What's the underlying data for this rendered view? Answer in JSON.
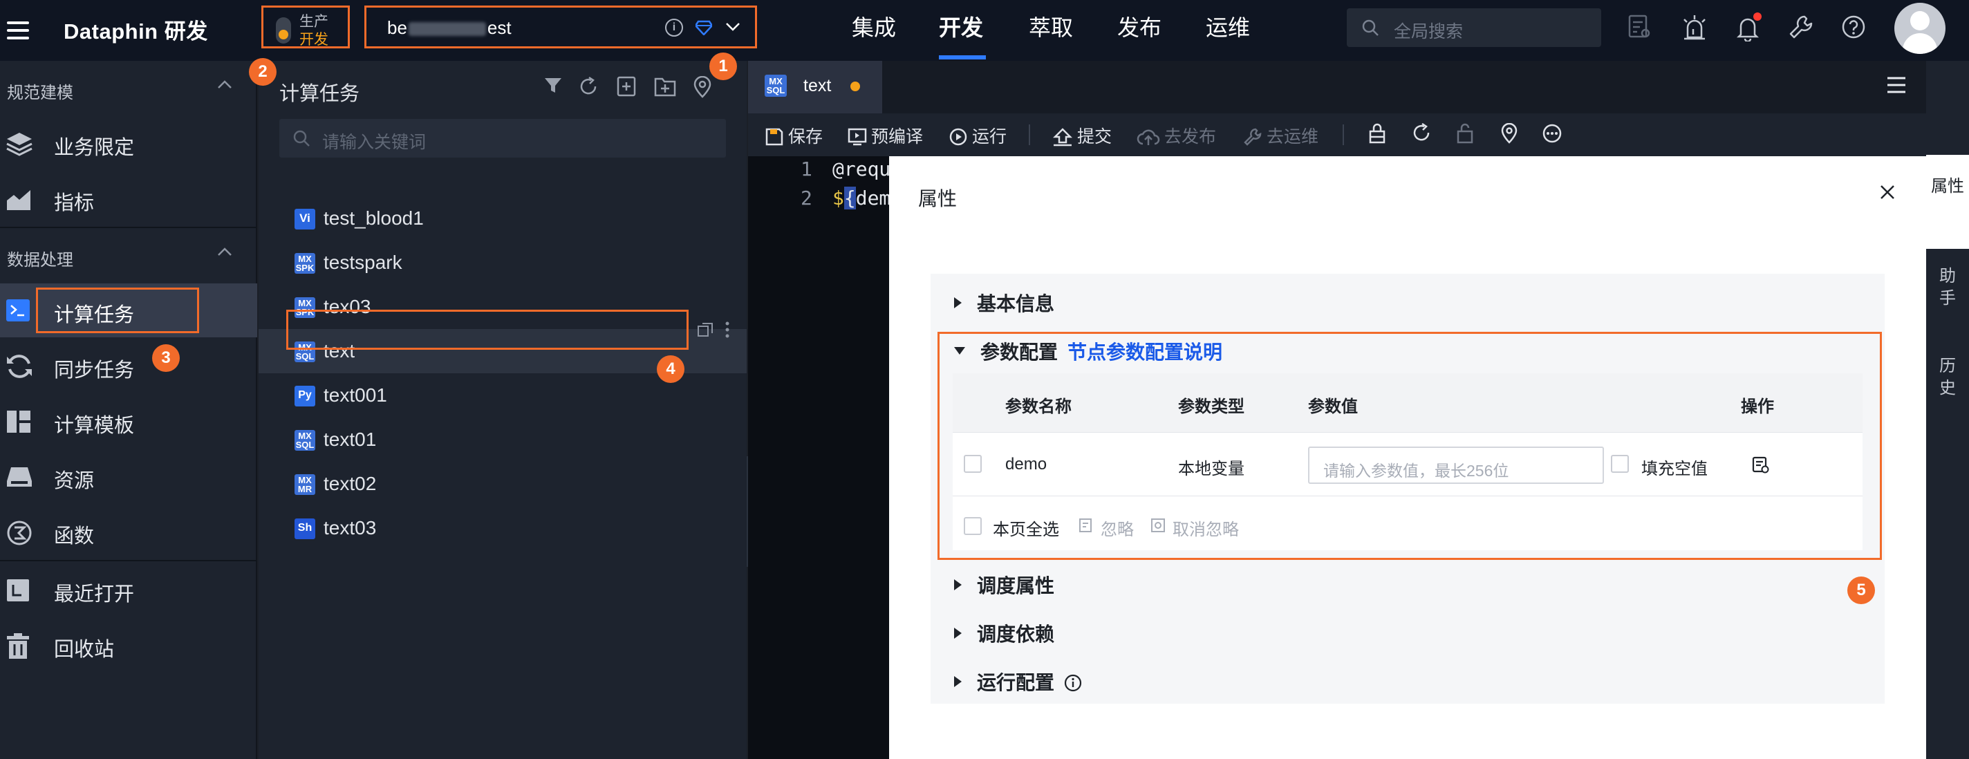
{
  "topbar": {
    "brand": "Dataphin 研发",
    "env": {
      "prod": "生产",
      "dev": "开发"
    },
    "project": {
      "name_start": "be",
      "name_end": "est"
    },
    "nav": [
      "集成",
      "开发",
      "萃取",
      "发布",
      "运维"
    ],
    "active_nav": "开发",
    "search_placeholder": "全局搜索"
  },
  "leftnav": {
    "groups": [
      {
        "label": "规范建模",
        "items": [
          "业务限定",
          "指标"
        ]
      },
      {
        "label": "数据处理",
        "items": [
          "计算任务",
          "同步任务",
          "计算模板",
          "资源",
          "函数"
        ]
      }
    ],
    "bottom_items": [
      "最近打开",
      "回收站"
    ],
    "active": "计算任务"
  },
  "taskpanel": {
    "title": "计算任务",
    "search_placeholder": "请输入关键词",
    "files": [
      {
        "name": "test_blood1",
        "type": "Vi"
      },
      {
        "name": "testspark",
        "type": "SPK"
      },
      {
        "name": "tex03",
        "type": "SPK"
      },
      {
        "name": "text",
        "type": "SQL"
      },
      {
        "name": "text001",
        "type": "Py"
      },
      {
        "name": "text01",
        "type": "SQL"
      },
      {
        "name": "text02",
        "type": "MR"
      },
      {
        "name": "text03",
        "type": "Sh"
      }
    ],
    "selected": "text"
  },
  "editor": {
    "tab": {
      "name": "text",
      "badge": "MX SQL"
    },
    "toolbar": [
      "保存",
      "预编译",
      "运行",
      "提交",
      "去发布",
      "去运维"
    ],
    "lines": [
      {
        "num": "1",
        "text": "@requ"
      },
      {
        "num": "2",
        "prefix": "$",
        "brace": "{",
        "text": "dem"
      }
    ]
  },
  "drawer": {
    "title": "属性",
    "sections": [
      "基本信息",
      "参数配置",
      "调度属性",
      "调度依赖",
      "运行配置"
    ],
    "param_link": "节点参数配置说明",
    "table": {
      "headers": [
        "参数名称",
        "参数类型",
        "参数值",
        "操作"
      ],
      "rows": [
        {
          "name": "demo",
          "type": "本地变量",
          "value_placeholder": "请输入参数值，最长256位",
          "fill_empty": "填充空值"
        }
      ],
      "footer": {
        "select_all": "本页全选",
        "ignore": "忽略",
        "unignore": "取消忽略"
      }
    }
  },
  "rail": [
    "属性",
    "助手",
    "历史"
  ],
  "callouts": [
    "1",
    "2",
    "3",
    "4",
    "5"
  ],
  "colors": {
    "accent": "#f26b2a",
    "primary": "#2f7bff",
    "link": "#1a5ae8",
    "warning": "#f7a21a"
  }
}
